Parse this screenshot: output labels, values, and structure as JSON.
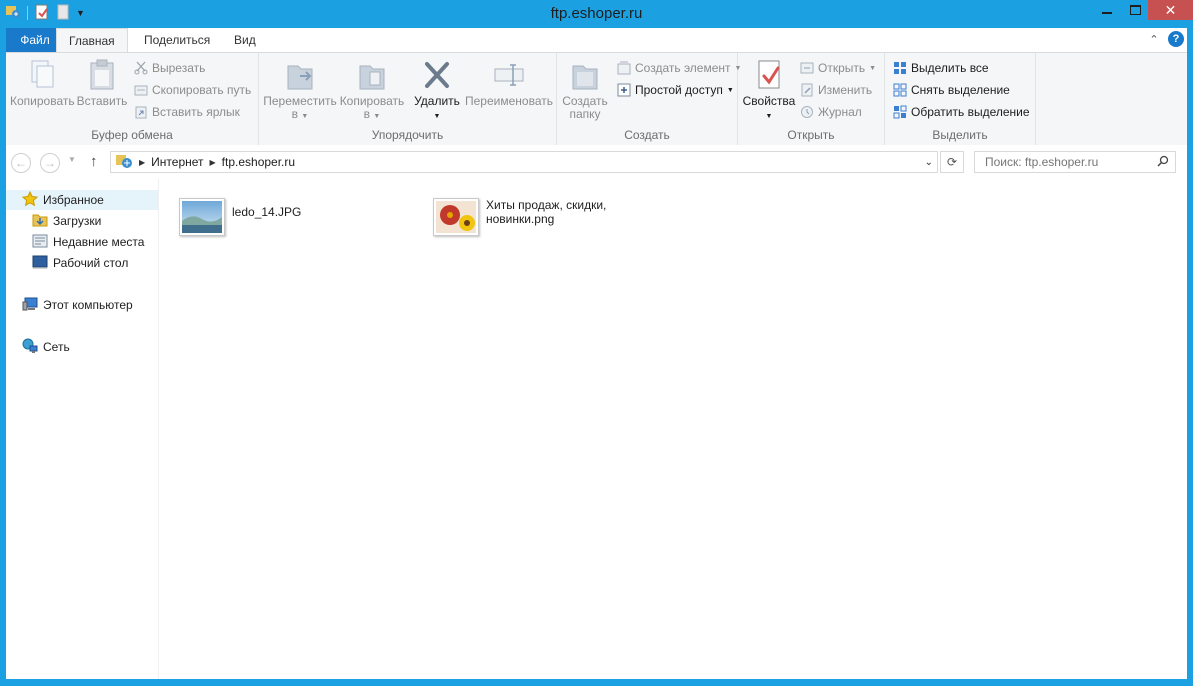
{
  "window": {
    "title": "ftp.eshoper.ru",
    "accent": "#1ba1e2"
  },
  "ribbon": {
    "tabs": {
      "file": "Файл",
      "home": "Главная",
      "share": "Поделиться",
      "view": "Вид"
    },
    "clipboard": {
      "label": "Буфер обмена",
      "copy": "Копировать",
      "paste": "Вставить",
      "cut": "Вырезать",
      "copy_path": "Скопировать путь",
      "paste_shortcut": "Вставить ярлык"
    },
    "organize": {
      "label": "Упорядочить",
      "move_to_1": "Переместить",
      "move_to_2": "в",
      "copy_to_1": "Копировать",
      "copy_to_2": "в",
      "delete": "Удалить",
      "rename": "Переименовать"
    },
    "new": {
      "label": "Создать",
      "new_folder_1": "Создать",
      "new_folder_2": "папку",
      "new_item": "Создать элемент",
      "easy_access": "Простой доступ"
    },
    "open": {
      "label": "Открыть",
      "properties": "Свойства",
      "open": "Открыть",
      "edit": "Изменить",
      "history": "Журнал"
    },
    "select": {
      "label": "Выделить",
      "select_all": "Выделить все",
      "select_none": "Снять выделение",
      "invert": "Обратить выделение"
    }
  },
  "address": {
    "crumbs": [
      "Интернет",
      "ftp.eshoper.ru"
    ],
    "search_placeholder": "Поиск: ftp.eshoper.ru"
  },
  "nav": {
    "favorites": "Избранное",
    "downloads": "Загрузки",
    "recent": "Недавние места",
    "desktop": "Рабочий стол",
    "computer": "Этот компьютер",
    "network": "Сеть"
  },
  "files": [
    {
      "name": "ledo_14.JPG"
    },
    {
      "name": "Хиты продаж, скидки, новинки.png"
    }
  ]
}
